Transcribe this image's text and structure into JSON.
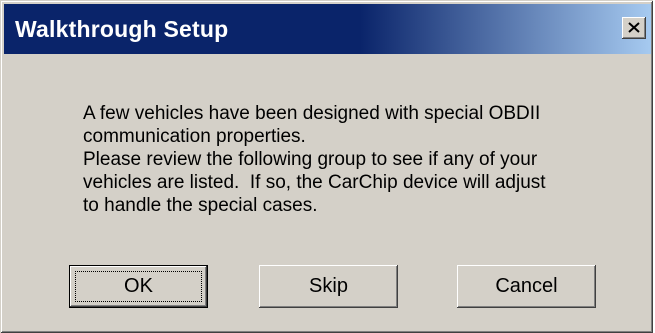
{
  "window": {
    "title": "Walkthrough Setup",
    "close_glyph": "x"
  },
  "message": {
    "line1": "A few vehicles have been designed with special OBDII",
    "line2": "communication properties.",
    "line3": "Please review the following group to see if any of your",
    "line4": "vehicles are listed.  If so, the CarChip device will adjust",
    "line5": "to handle the special cases."
  },
  "buttons": {
    "ok": "OK",
    "skip": "Skip",
    "cancel": "Cancel"
  },
  "colors": {
    "titlebar_start": "#0a246a",
    "titlebar_end": "#a6caf0",
    "face": "#d4d0c8"
  },
  "icons": {
    "close": "close-icon"
  }
}
